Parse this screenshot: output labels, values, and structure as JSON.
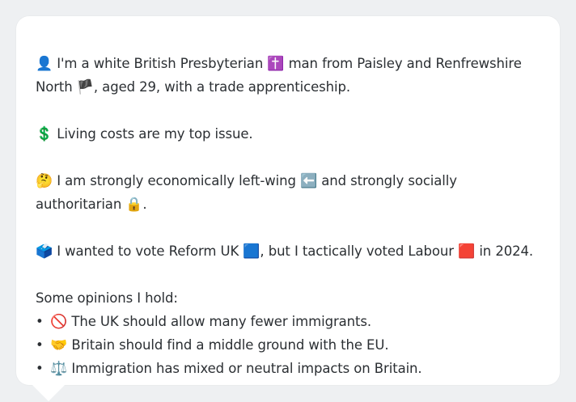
{
  "intro": {
    "icon": "👤",
    "part1": "I'm a white British Presbyterian",
    "religion_icon": "✝️",
    "part2": "man from Paisley and Renfrewshire",
    "part3": "North",
    "flag_icon": "🏴",
    "part4": ", aged 29, with a trade apprenticeship."
  },
  "issue": {
    "icon": "💲",
    "text": "Living costs are my top issue."
  },
  "ideology": {
    "icon": "🤔",
    "part1": "I am strongly economically left-wing",
    "left_icon": "⬅️",
    "part2": "and strongly socially authoritarian",
    "lock_icon": "🔒",
    "part3": "."
  },
  "vote": {
    "icon": "🗳️",
    "part1": "I wanted to vote Reform UK",
    "reform_icon": "🟦",
    "part2": ", but I tactically voted Labour",
    "labour_icon": "🟥",
    "part3": "in 2024."
  },
  "opinions": {
    "heading": "Some opinions I hold:",
    "bullet": "•",
    "items": [
      {
        "icon": "🚫",
        "text": "The UK should allow many fewer immigrants."
      },
      {
        "icon": "🤝",
        "text": "Britain should find a middle ground with the EU."
      },
      {
        "icon": "⚖️",
        "text": "Immigration has mixed or neutral impacts on Britain."
      }
    ]
  }
}
